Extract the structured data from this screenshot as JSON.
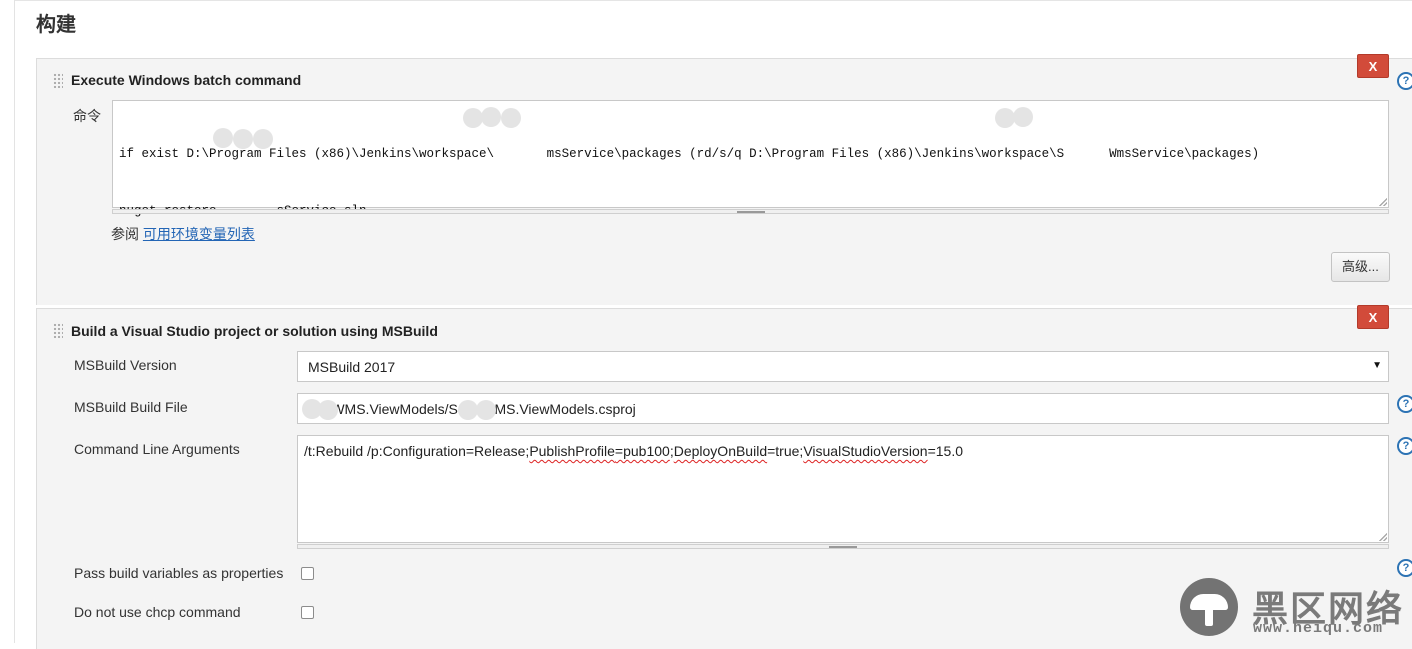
{
  "section": {
    "title": "构建"
  },
  "step1": {
    "title": "Execute Windows batch command",
    "delete_label": "X",
    "command_label": "命令",
    "command_line1": "if exist D:\\Program Files (x86)\\Jenkins\\workspace\\       msService\\packages (rd/s/q D:\\Program Files (x86)\\Jenkins\\workspace\\S      WmsService\\packages)",
    "command_line2": "nuget restore        sService.sln",
    "see_prefix": "参阅",
    "env_link": "可用环境变量列表",
    "advanced_label": "高级..."
  },
  "step2": {
    "title": "Build a Visual Studio project or solution using MSBuild",
    "delete_label": "X",
    "msbuild_version_label": "MSBuild Version",
    "msbuild_version_value": "MSBuild 2017",
    "build_file_label": "MSBuild Build File",
    "build_file_value": "      WMS.ViewModels/S      WMS.ViewModels.csproj",
    "args_label": "Command Line Arguments",
    "args_parts": [
      "/t:Rebuild /p:Configuration=Release",
      ";",
      "PublishProfile",
      "=pub100",
      ";",
      "DeployOnBuild",
      "=true",
      ";",
      "VisualStudioVersion",
      "=15.0"
    ],
    "pass_vars_label": "Pass build variables as properties",
    "no_chcp_label": "Do not use chcp command",
    "pass_vars_checked": false,
    "no_chcp_checked": false
  },
  "help_glyph": "?",
  "select_arrow": "▼",
  "watermark": {
    "text": "黑区网络",
    "url": "www.heiqu.com"
  },
  "colors": {
    "delete_red": "#d24b3a",
    "link_blue": "#2365b5",
    "help_blue": "#2c73b4",
    "panel_bg": "#f4f4f4"
  }
}
